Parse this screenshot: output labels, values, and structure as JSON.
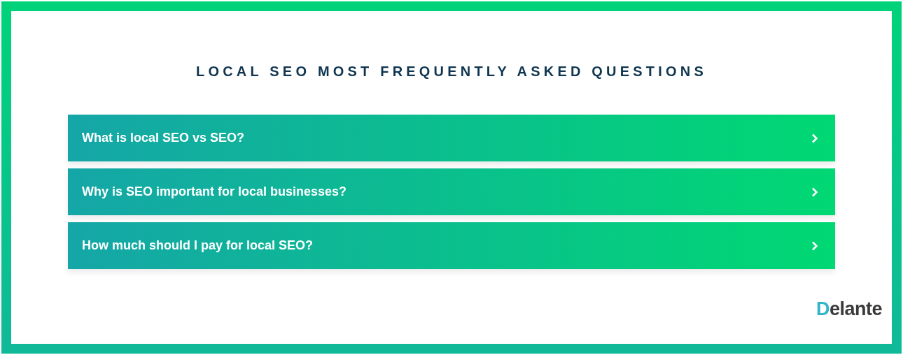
{
  "title": "LOCAL SEO MOST FREQUENTLY ASKED QUESTIONS",
  "faq": [
    {
      "question": "What is local SEO vs SEO?",
      "expanded": false
    },
    {
      "question": "Why is SEO important for local businesses?",
      "expanded": false
    },
    {
      "question": "How much should I pay for local SEO?",
      "expanded": false
    }
  ],
  "logo": "Delante"
}
